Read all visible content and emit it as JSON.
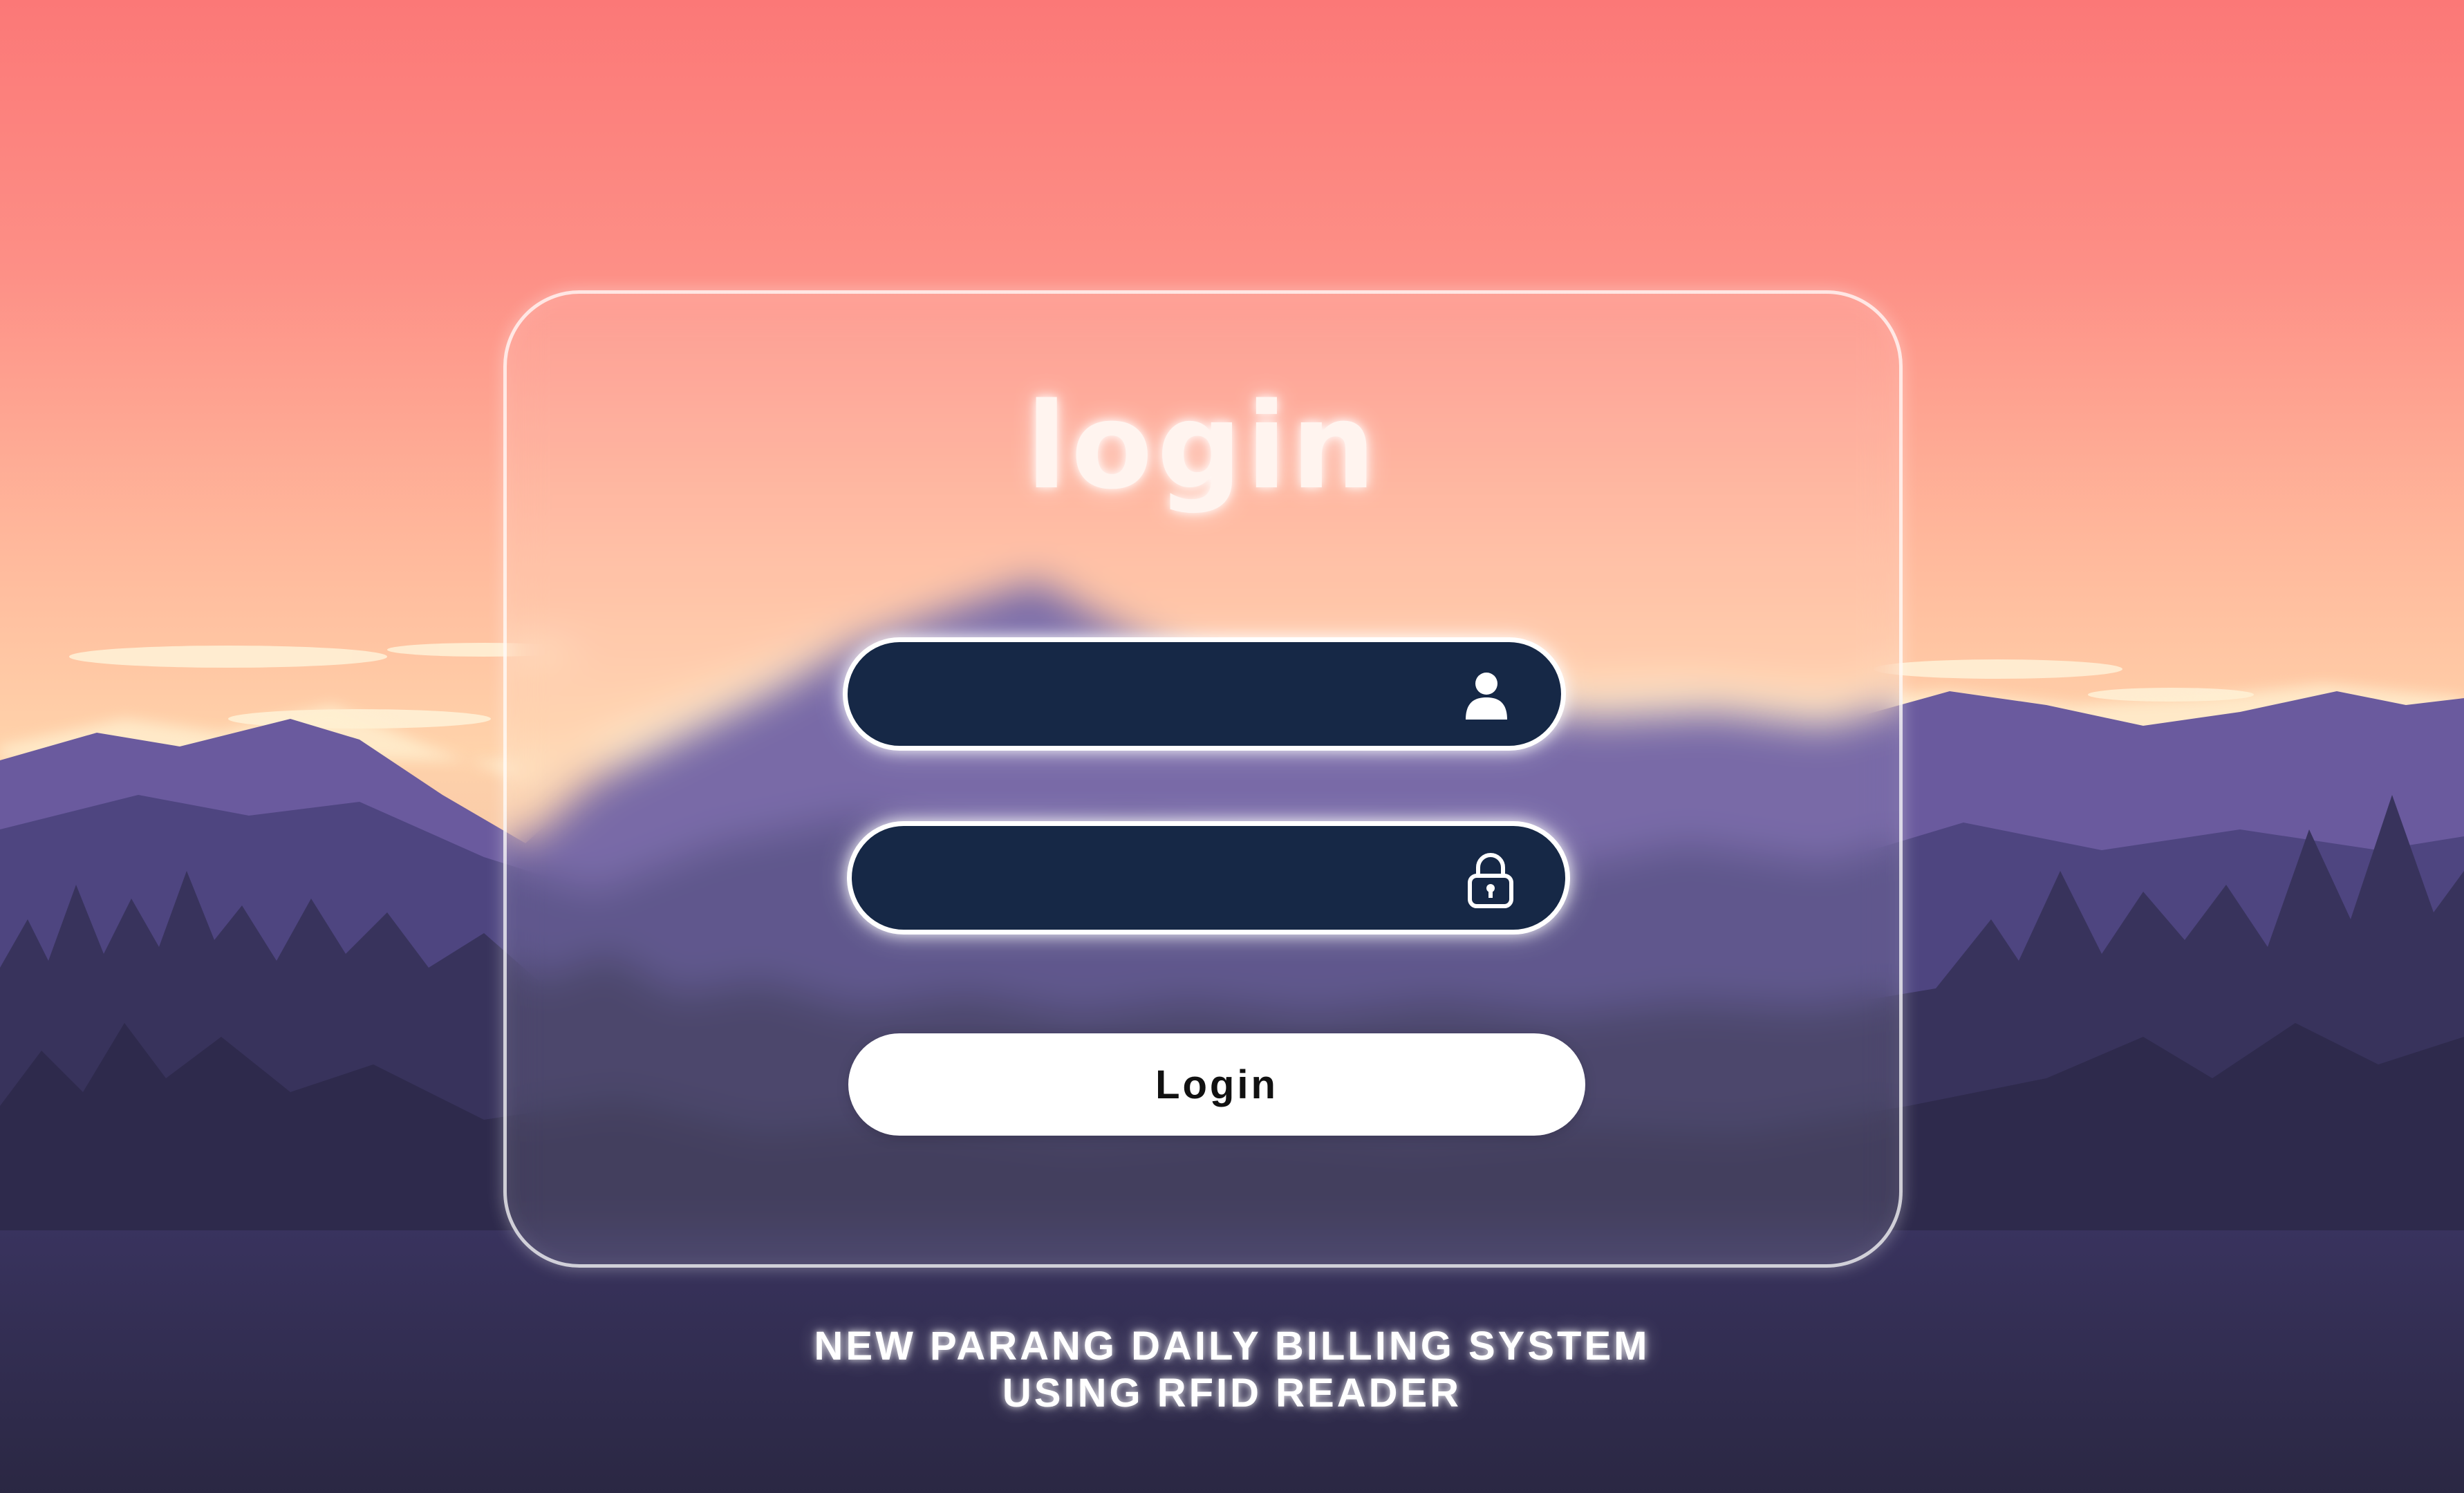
{
  "login_card": {
    "title": "login",
    "username": {
      "value": "",
      "placeholder": "",
      "icon": "user-icon"
    },
    "password": {
      "value": "",
      "placeholder": "",
      "icon": "lock-icon"
    },
    "submit_label": "Login"
  },
  "footer": {
    "line1": "NEW PARANG DAILY BILLING SYSTEM",
    "line2": "USING RFID READER"
  },
  "colors": {
    "sky_top": "#fb7c7a",
    "sky_horizon": "#ffd0a6",
    "mountains": "#5a4a8e",
    "forest": "#2d2a48",
    "field_bg": "#162846",
    "button_bg": "#ffffff"
  }
}
